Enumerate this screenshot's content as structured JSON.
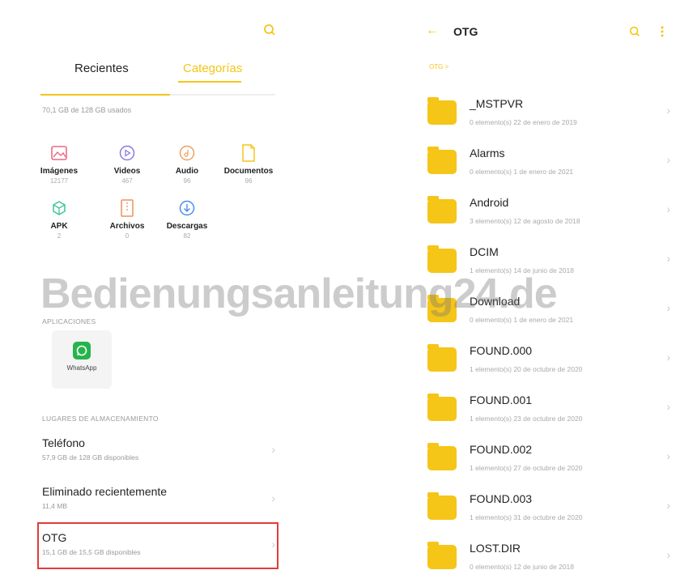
{
  "left": {
    "tabs": [
      "Recientes",
      "Categorías"
    ],
    "storage_used_text": "70,1 GB de 128 GB usados",
    "storage_used_fraction": 0.55,
    "categories": [
      {
        "label": "Imágenes",
        "count": "12177",
        "icon": "image-icon",
        "color": "#e96b86"
      },
      {
        "label": "Videos",
        "count": "467",
        "icon": "video-icon",
        "color": "#8a7ae0"
      },
      {
        "label": "Audio",
        "count": "96",
        "icon": "audio-icon",
        "color": "#f0a060"
      },
      {
        "label": "Documentos",
        "count": "96",
        "icon": "document-icon",
        "color": "#f5c518"
      },
      {
        "label": "APK",
        "count": "2",
        "icon": "apk-icon",
        "color": "#3cc39a"
      },
      {
        "label": "Archivos",
        "count": "0",
        "icon": "archive-icon",
        "color": "#f0905a"
      },
      {
        "label": "Descargas",
        "count": "82",
        "icon": "download-icon",
        "color": "#4a8cf0"
      }
    ],
    "apps_title": "APLICACIONES",
    "apps": [
      {
        "label": "WhatsApp",
        "icon": "whatsapp-icon",
        "color": "#25b44c"
      }
    ],
    "storage_title": "LUGARES DE ALMACENAMIENTO",
    "storage_places": [
      {
        "title": "Teléfono",
        "sub": "57,9 GB de 128 GB disponibles"
      },
      {
        "title": "Eliminado recientemente",
        "sub": "11,4 MB"
      },
      {
        "title": "OTG",
        "sub": "15,1 GB de 15,5 GB disponibles"
      }
    ]
  },
  "right": {
    "title": "OTG",
    "breadcrumb": "OTG >",
    "folders": [
      {
        "name": "_MSTPVR",
        "meta": "0 elemento(s)   22 de enero de 2019"
      },
      {
        "name": "Alarms",
        "meta": "0 elemento(s)   1 de enero de 2021"
      },
      {
        "name": "Android",
        "meta": "3 elemento(s)   12 de agosto de 2018"
      },
      {
        "name": "DCIM",
        "meta": "1 elemento(s)   14 de junio de 2018"
      },
      {
        "name": "Download",
        "meta": "0 elemento(s)   1 de enero de 2021"
      },
      {
        "name": "FOUND.000",
        "meta": "1 elemento(s)   20 de octubre de 2020"
      },
      {
        "name": "FOUND.001",
        "meta": "1 elemento(s)   23 de octubre de 2020"
      },
      {
        "name": "FOUND.002",
        "meta": "1 elemento(s)   27 de octubre de 2020"
      },
      {
        "name": "FOUND.003",
        "meta": "1 elemento(s)   31 de octubre de 2020"
      },
      {
        "name": "LOST.DIR",
        "meta": "0 elemento(s)   12 de junio de 2018"
      }
    ]
  },
  "watermark": "Bedienungsanleitung24.de",
  "accent_color": "#f5c518",
  "highlight_color": "#e33b3b"
}
